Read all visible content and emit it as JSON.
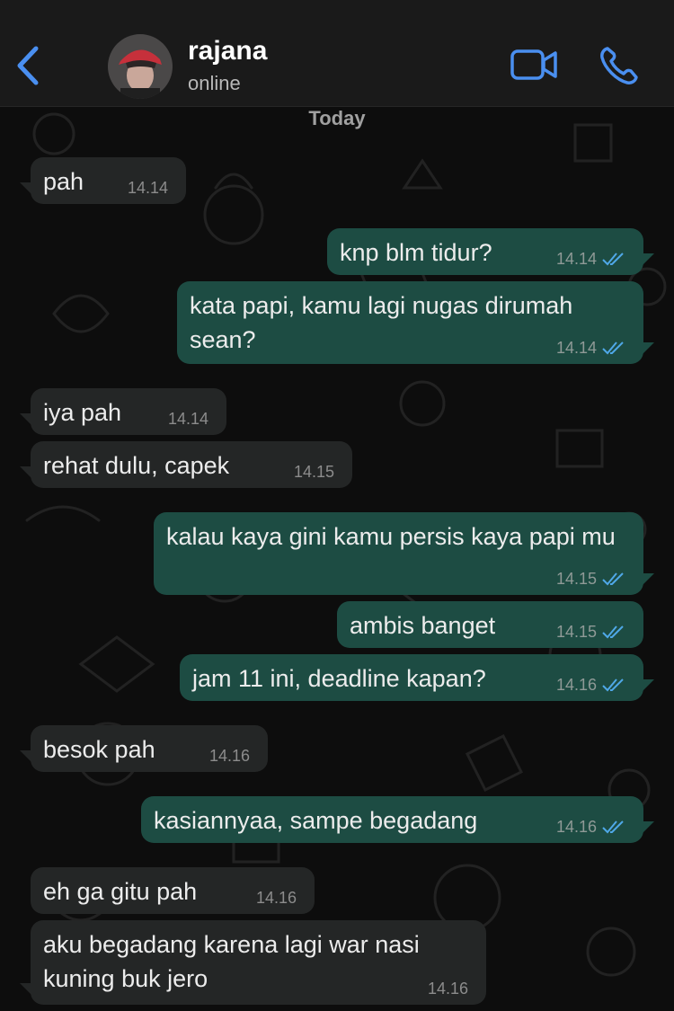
{
  "header": {
    "contact_name": "rajana",
    "status": "online",
    "accent_color": "#4a8ff0"
  },
  "chat": {
    "date_label": "Today",
    "messages": [
      {
        "direction": "incoming",
        "text": "pah",
        "time": "14.14"
      },
      {
        "direction": "outgoing",
        "text": "knp blm tidur?",
        "time": "14.14",
        "read": true
      },
      {
        "direction": "outgoing",
        "text": "kata papi, kamu lagi nugas dirumah sean?",
        "time": "14.14",
        "read": true
      },
      {
        "direction": "incoming",
        "text": "iya pah",
        "time": "14.14"
      },
      {
        "direction": "incoming",
        "text": "rehat dulu, capek",
        "time": "14.15"
      },
      {
        "direction": "outgoing",
        "text": "kalau kaya gini kamu persis kaya papi mu",
        "time": "14.15",
        "read": true
      },
      {
        "direction": "outgoing",
        "text": "ambis banget",
        "time": "14.15",
        "read": true
      },
      {
        "direction": "outgoing",
        "text": "jam 11 ini, deadline kapan?",
        "time": "14.16",
        "read": true
      },
      {
        "direction": "incoming",
        "text": "besok pah",
        "time": "14.16"
      },
      {
        "direction": "outgoing",
        "text": "kasiannyaa, sampe begadang",
        "time": "14.16",
        "read": true
      },
      {
        "direction": "incoming",
        "text": "eh ga gitu pah",
        "time": "14.16"
      },
      {
        "direction": "incoming",
        "text": "aku begadang karena lagi war nasi kuning buk jero",
        "time": "14.16"
      }
    ]
  },
  "colors": {
    "incoming_bubble": "#242626",
    "outgoing_bubble": "#1d4c43",
    "read_tick": "#4fa8e8"
  },
  "icons": [
    "back-chevron-icon",
    "video-call-icon",
    "phone-icon",
    "double-check-icon"
  ]
}
